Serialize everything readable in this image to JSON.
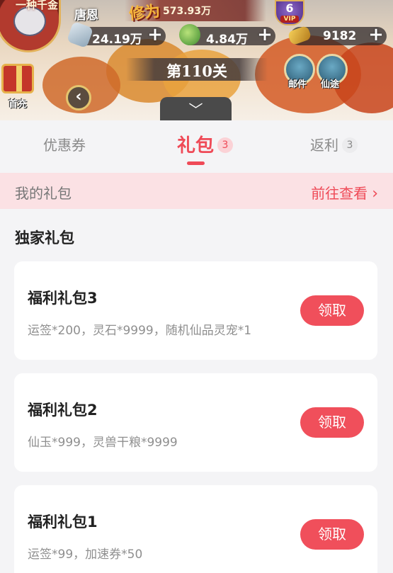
{
  "header": {
    "portrait_tag": "一种千金",
    "player_name": "唐恩",
    "cultivation_label": "修为",
    "cultivation_value": "573.93万",
    "vip_level": "6",
    "vip_text": "VIP",
    "resources": [
      {
        "icon": "spirit-stone-icon",
        "value": "24.19万"
      },
      {
        "icon": "jade-icon",
        "value": "4.84万"
      },
      {
        "icon": "ticket-icon",
        "value": "9182"
      }
    ],
    "plus_glyph": "+",
    "level": "第110关",
    "mail_label": "邮件",
    "journey_label": "仙途",
    "first_recharge_label": "首充",
    "back_glyph": "‹",
    "collapse_glyph": "﹀"
  },
  "tabs": [
    {
      "label": "优惠券",
      "count": ""
    },
    {
      "label": "礼包",
      "count": "3",
      "active": true
    },
    {
      "label": "返利",
      "count": "3"
    }
  ],
  "my_gifts": {
    "label": "我的礼包",
    "link": "前往查看",
    "chevron": "›"
  },
  "section_title": "独家礼包",
  "packs": [
    {
      "title": "福利礼包3",
      "desc": "运签*200，灵石*9999，随机仙品灵宠*1",
      "button": "领取"
    },
    {
      "title": "福利礼包2",
      "desc": "仙玉*999，灵兽干粮*9999",
      "button": "领取"
    },
    {
      "title": "福利礼包1",
      "desc": "运签*99，加速券*50",
      "button": "领取"
    }
  ],
  "colors": {
    "accent": "#ef4a57",
    "banner_bg": "#fbe1e4",
    "card_bg": "#ffffff"
  }
}
